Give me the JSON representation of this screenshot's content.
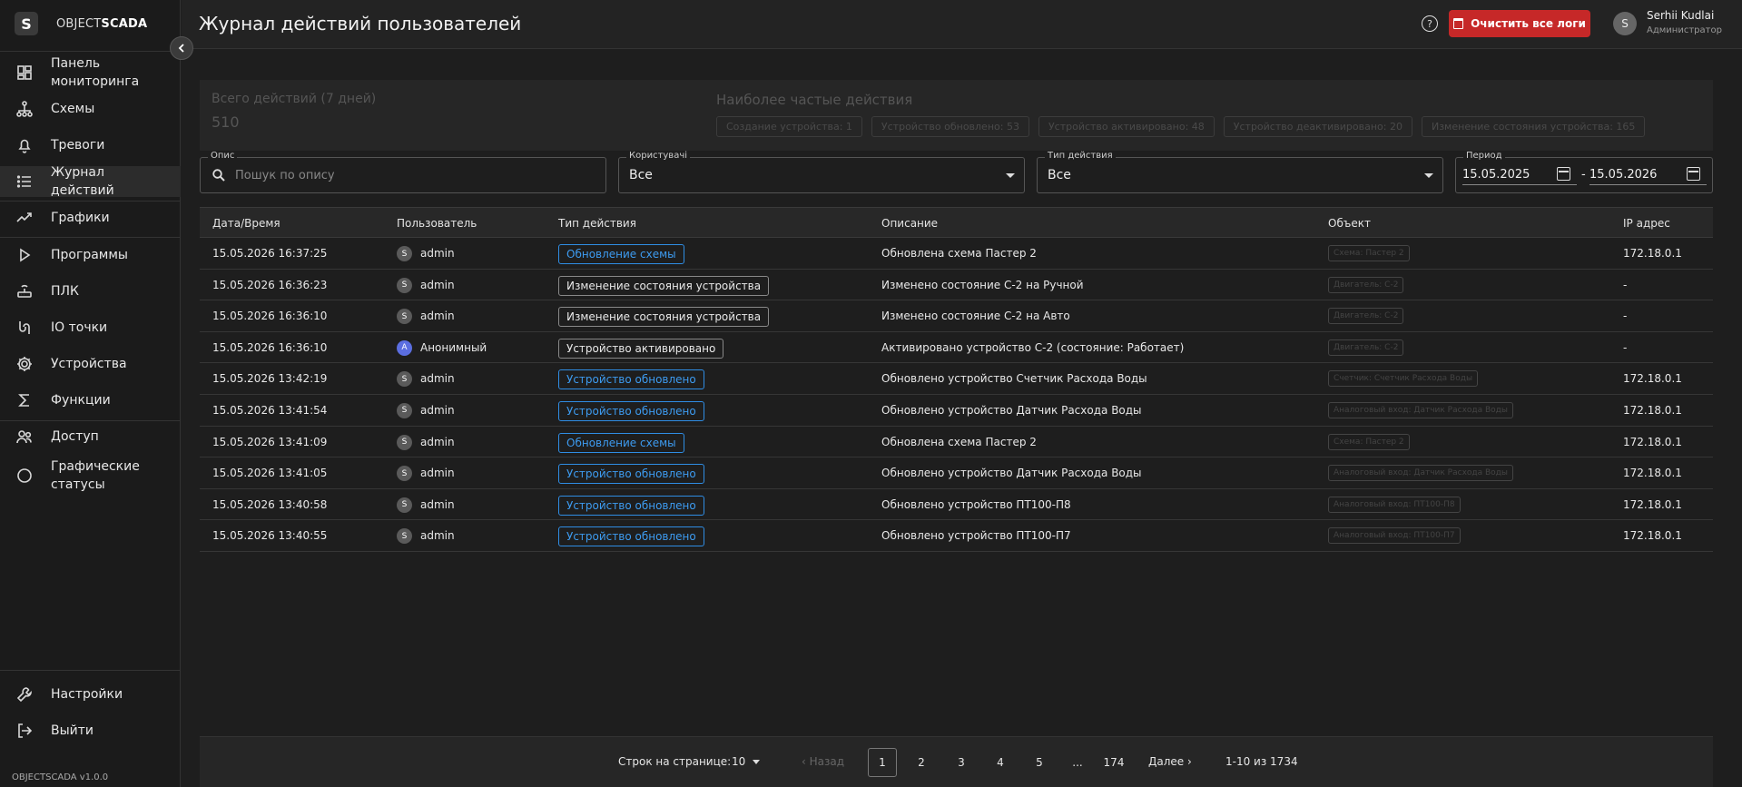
{
  "brand": {
    "logo": "S",
    "name_light": "OBJECT",
    "name_bold": "SCADA"
  },
  "sidebar": {
    "items": [
      {
        "label": "Панель мониторинга",
        "icon": "dashboard-icon"
      },
      {
        "label": "Схемы",
        "icon": "schema-icon"
      },
      {
        "label": "Тревоги",
        "icon": "bell-icon"
      },
      {
        "label": "Журнал действий",
        "icon": "list-icon",
        "active": true
      },
      {
        "label": "Графики",
        "icon": "trend-icon"
      },
      {
        "label": "Программы",
        "icon": "play-icon"
      },
      {
        "label": "ПЛК",
        "icon": "router-icon"
      },
      {
        "label": "IO точки",
        "icon": "io-icon"
      },
      {
        "label": "Устройства",
        "icon": "gear-icon"
      },
      {
        "label": "Функции",
        "icon": "sigma-icon"
      },
      {
        "label": "Доступ",
        "icon": "users-icon"
      },
      {
        "label": "Графические статусы",
        "icon": "circle-icon"
      }
    ],
    "bottom": [
      {
        "label": "Настройки",
        "icon": "wrench-icon"
      },
      {
        "label": "Выйти",
        "icon": "logout-icon"
      }
    ],
    "version": "OBJECTSCADA v1.0.0"
  },
  "header": {
    "title": "Журнал действий пользователей",
    "help": "?",
    "clear_label": "Очистить все логи",
    "user_initial": "S",
    "user_name": "Serhii Kudlai",
    "user_role": "Администратор"
  },
  "stats": {
    "total_label": "Всего действий (7 дней)",
    "total_value": "510",
    "frequent_label": "Наиболее частые действия",
    "chips": [
      "Создание устройства: 1",
      "Устройство обновлено: 53",
      "Устройство активировано: 48",
      "Устройство деактивировано: 20",
      "Изменение состояния устройства: 165"
    ]
  },
  "filters": {
    "description_label": "Опис",
    "description_placeholder": "Пошук по опису",
    "users_label": "Користувачі",
    "users_value": "Все",
    "type_label": "Тип действия",
    "type_value": "Все",
    "period_label": "Период",
    "date_from": "15.05.2025",
    "date_sep": "-",
    "date_to": "15.05.2026"
  },
  "table": {
    "headers": [
      "Дата/Время",
      "Пользователь",
      "Тип действия",
      "Описание",
      "Объект",
      "IP адрес"
    ],
    "rows": [
      {
        "date": "15.05.2026 16:37:25",
        "initial": "S",
        "user": "admin",
        "type": "Обновление схемы",
        "blue": true,
        "desc": "Обновлена схема Пастер 2",
        "obj": "Схема: Пастер 2",
        "ip": "172.18.0.1"
      },
      {
        "date": "15.05.2026 16:36:23",
        "initial": "S",
        "user": "admin",
        "type": "Изменение состояния устройства",
        "blue": false,
        "desc": "Изменено состояние С-2 на Ручной",
        "obj": "Двигатель: С-2",
        "ip": "-"
      },
      {
        "date": "15.05.2026 16:36:10",
        "initial": "S",
        "user": "admin",
        "type": "Изменение состояния устройства",
        "blue": false,
        "desc": "Изменено состояние С-2 на Авто",
        "obj": "Двигатель: С-2",
        "ip": "-"
      },
      {
        "date": "15.05.2026 16:36:10",
        "initial": "A",
        "user": "Анонимный",
        "type": "Устройство активировано",
        "blue": false,
        "desc": "Активировано устройство С-2 (состояние: Работает)",
        "obj": "Двигатель: С-2",
        "ip": "-",
        "anon": true
      },
      {
        "date": "15.05.2026 13:42:19",
        "initial": "S",
        "user": "admin",
        "type": "Устройство обновлено",
        "blue": true,
        "desc": "Обновлено устройство Счетчик Расхода Воды",
        "obj": "Счетчик: Счетчик Расхода Воды",
        "ip": "172.18.0.1"
      },
      {
        "date": "15.05.2026 13:41:54",
        "initial": "S",
        "user": "admin",
        "type": "Устройство обновлено",
        "blue": true,
        "desc": "Обновлено устройство Датчик Расхода Воды",
        "obj": "Аналоговый вход: Датчик Расхода Воды",
        "ip": "172.18.0.1"
      },
      {
        "date": "15.05.2026 13:41:09",
        "initial": "S",
        "user": "admin",
        "type": "Обновление схемы",
        "blue": true,
        "desc": "Обновлена схема Пастер 2",
        "obj": "Схема: Пастер 2",
        "ip": "172.18.0.1"
      },
      {
        "date": "15.05.2026 13:41:05",
        "initial": "S",
        "user": "admin",
        "type": "Устройство обновлено",
        "blue": true,
        "desc": "Обновлено устройство Датчик Расхода Воды",
        "obj": "Аналоговый вход: Датчик Расхода Воды",
        "ip": "172.18.0.1"
      },
      {
        "date": "15.05.2026 13:40:58",
        "initial": "S",
        "user": "admin",
        "type": "Устройство обновлено",
        "blue": true,
        "desc": "Обновлено устройство ПТ100-П8",
        "obj": "Аналоговый вход: ПТ100-П8",
        "ip": "172.18.0.1"
      },
      {
        "date": "15.05.2026 13:40:55",
        "initial": "S",
        "user": "admin",
        "type": "Устройство обновлено",
        "blue": true,
        "desc": "Обновлено устройство ПТ100-П7",
        "obj": "Аналоговый вход: ПТ100-П7",
        "ip": "172.18.0.1"
      }
    ]
  },
  "pagination": {
    "rows_label": "Строк на странице:",
    "rows_value": "10",
    "prev_label": "Назад",
    "pages": [
      "1",
      "2",
      "3",
      "4",
      "5",
      "...",
      "174"
    ],
    "active_page": "1",
    "next_label": "Далее",
    "range": "1-10 из 1734"
  },
  "colors": {
    "accent_red": "#c62828",
    "tag_blue": "#3d9bf0",
    "anon_avatar": "#5b6ee0"
  }
}
